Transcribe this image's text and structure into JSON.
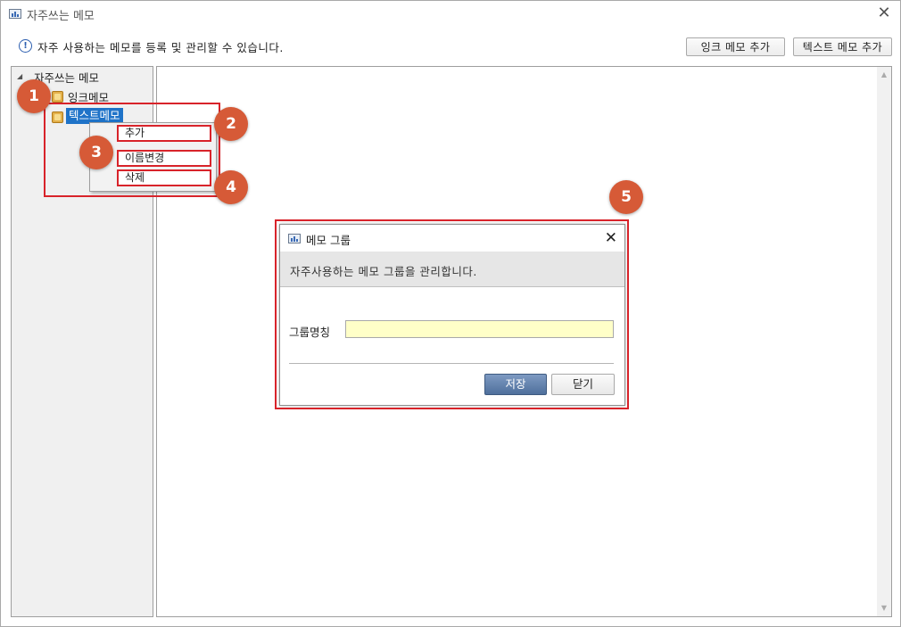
{
  "window": {
    "title": "자주쓰는 메모",
    "icon": "memo-app-icon",
    "close_glyph": "✕"
  },
  "info": {
    "icon": "info-icon",
    "icon_glyph": "!",
    "text": "자주 사용하는 메모를 등록 및 관리할 수 있습니다."
  },
  "toolbar": {
    "add_link_memo": "잉크 메모 추가",
    "add_text_memo": "텍스트 메모 추가"
  },
  "tree": {
    "root": {
      "label": "자주쓰는 메모",
      "expanded": true
    },
    "items": [
      {
        "label": "잉크메모",
        "icon": "package-icon",
        "selected": false
      },
      {
        "label": "텍스트메모",
        "icon": "package-icon",
        "selected": true
      }
    ]
  },
  "context_menu": {
    "items": [
      "추가",
      "이름변경",
      "삭제"
    ]
  },
  "badges": [
    "1",
    "2",
    "3",
    "4",
    "5"
  ],
  "dialog": {
    "title": "메모 그룹",
    "close_glyph": "✕",
    "description": "자주사용하는 메모 그룹을 관리합니다.",
    "group_name_label": "그룹명칭",
    "group_name_value": "",
    "save_label": "저장",
    "close_label": "닫기"
  },
  "colors": {
    "highlight": "#d8232a",
    "badge": "#d65a37",
    "selection": "#1f73c8",
    "input_bg": "#ffffc8",
    "save_btn": "#5b7aa8"
  }
}
